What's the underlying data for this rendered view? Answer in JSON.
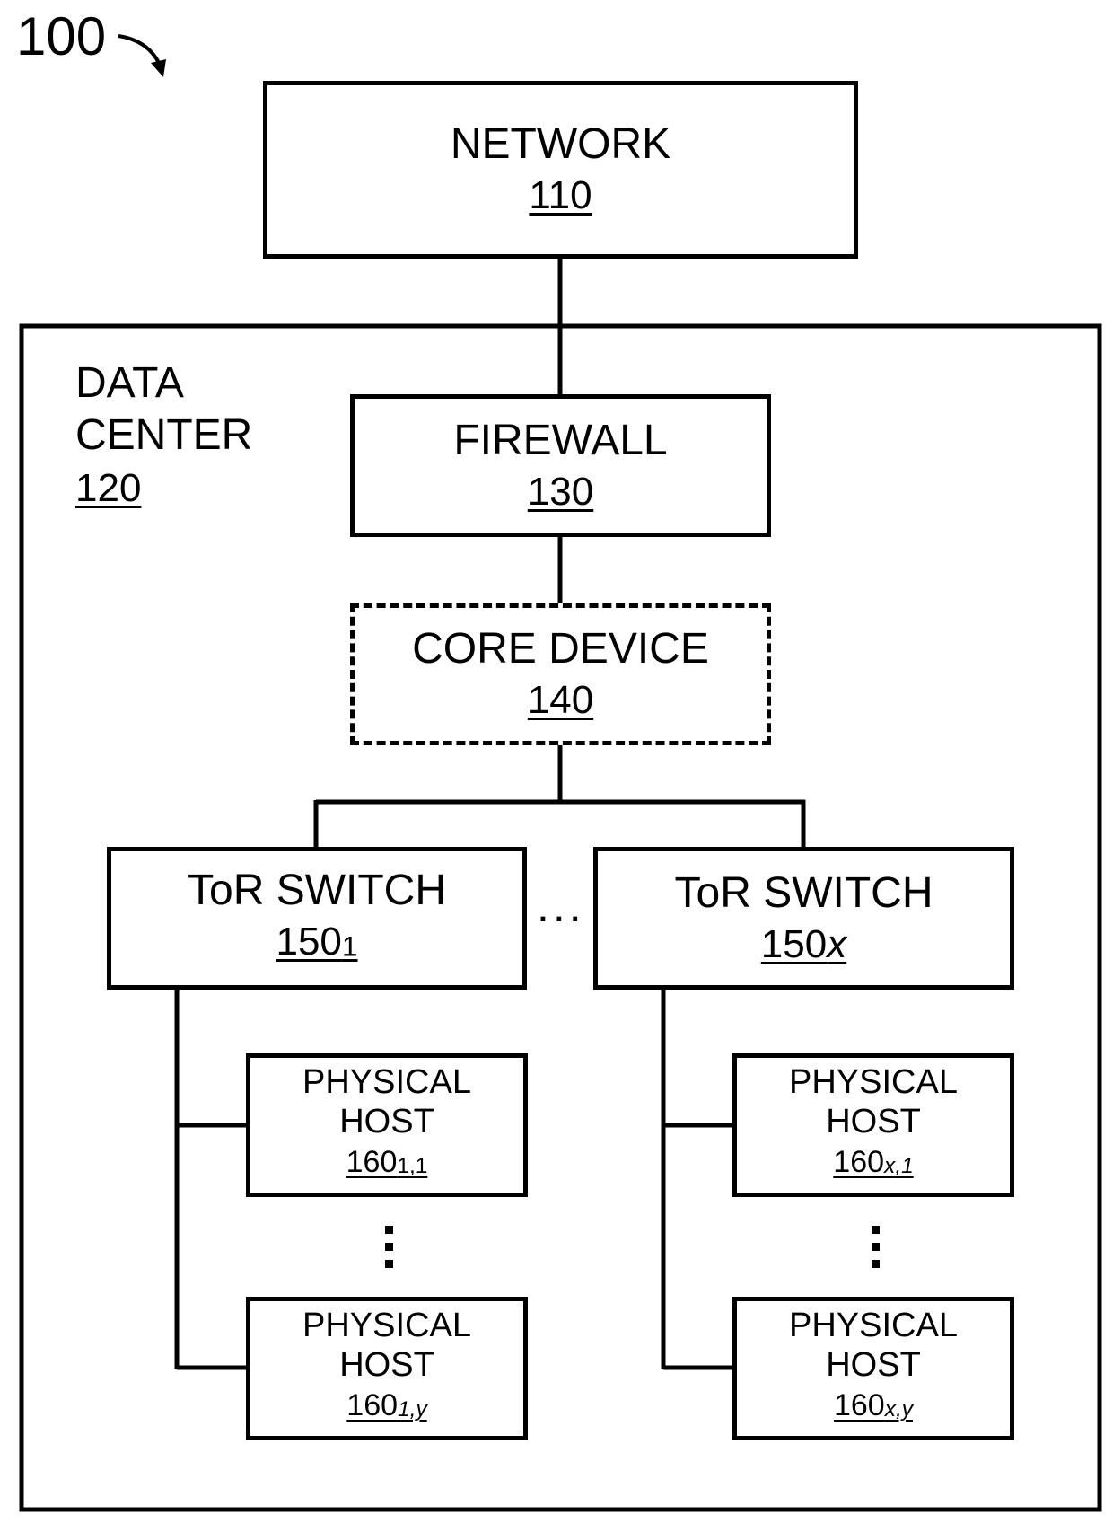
{
  "figure": {
    "number": "100"
  },
  "network": {
    "label": "NETWORK",
    "ref": "110"
  },
  "data_center": {
    "label_line1": "DATA",
    "label_line2": "CENTER",
    "ref": "120"
  },
  "firewall": {
    "label": "FIREWALL",
    "ref": "130"
  },
  "core_device": {
    "label": "CORE DEVICE",
    "ref": "140",
    "style": "dashed"
  },
  "tor_switches": [
    {
      "label": "ToR SWITCH",
      "ref_base": "150",
      "ref_sub": "1",
      "ref_sub_italic": false
    },
    {
      "label": "ToR SWITCH",
      "ref_base": "150",
      "ref_sub": "x",
      "ref_sub_italic": true
    }
  ],
  "hosts": [
    {
      "line1": "PHYSICAL",
      "line2": "HOST",
      "ref_base": "160",
      "ref_sub": "1,1"
    },
    {
      "line1": "PHYSICAL",
      "line2": "HOST",
      "ref_base": "160",
      "ref_sub": "1,y"
    },
    {
      "line1": "PHYSICAL",
      "line2": "HOST",
      "ref_base": "160",
      "ref_sub": "x,1"
    },
    {
      "line1": "PHYSICAL",
      "line2": "HOST",
      "ref_base": "160",
      "ref_sub": "x,y"
    }
  ],
  "ellipsis": {
    "horizontal": "...",
    "vertical": "⋮"
  }
}
